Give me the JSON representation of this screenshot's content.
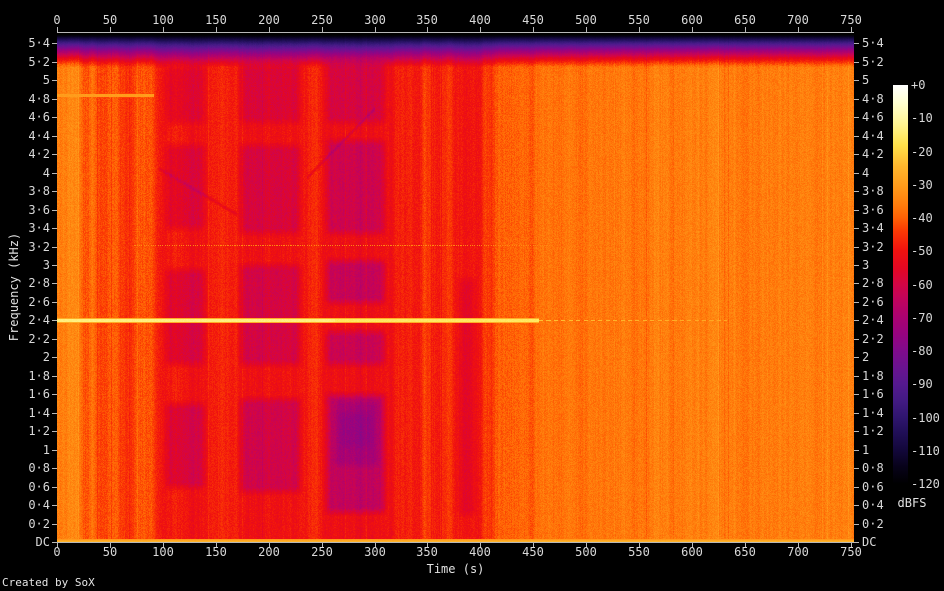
{
  "app": {
    "credit": "Created by SoX"
  },
  "chart_data": {
    "type": "heatmap",
    "subtype": "audio-spectrogram",
    "title": "",
    "xlabel": "Time (s)",
    "ylabel": "Frequency (kHz)",
    "x_range_s": [
      0,
      753
    ],
    "y_range_khz": [
      0,
      5.5125
    ],
    "x_tick_values": [
      0,
      50,
      100,
      150,
      200,
      250,
      300,
      350,
      400,
      450,
      500,
      550,
      600,
      650,
      700,
      750
    ],
    "x_tick_labels": [
      "0",
      "50",
      "100",
      "150",
      "200",
      "250",
      "300",
      "350",
      "400",
      "450",
      "500",
      "550",
      "600",
      "650",
      "700",
      "750"
    ],
    "y_tick_values": [
      0,
      0.2,
      0.4,
      0.6,
      0.8,
      1,
      1.2,
      1.4,
      1.6,
      1.8,
      2,
      2.2,
      2.4,
      2.6,
      2.8,
      3,
      3.2,
      3.4,
      3.6,
      3.8,
      4,
      4.2,
      4.4,
      4.6,
      4.8,
      5,
      5.2,
      5.4
    ],
    "y_tick_labels": [
      "DC",
      "0·2",
      "0·4",
      "0·6",
      "0·8",
      "1",
      "1·2",
      "1·4",
      "1·6",
      "1·8",
      "2",
      "2·2",
      "2·4",
      "2·6",
      "2·8",
      "3",
      "3·2",
      "3·4",
      "3·6",
      "3·8",
      "4",
      "4·2",
      "4·4",
      "4·6",
      "4·8",
      "5",
      "5·2",
      "5·4"
    ],
    "colorbar": {
      "label": "dBFS",
      "range_db": [
        0,
        -120
      ],
      "tick_values": [
        0,
        -10,
        -20,
        -30,
        -40,
        -50,
        -60,
        -70,
        -80,
        -90,
        -100,
        -110,
        -120
      ],
      "tick_labels": [
        "+0",
        "-10",
        "-20",
        "-30",
        "-40",
        "-50",
        "-60",
        "-70",
        "-80",
        "-90",
        "-100",
        "-110",
        "-120"
      ]
    },
    "palette": [
      [
        0.0,
        "#ffffff"
      ],
      [
        0.045,
        "#ffffd0"
      ],
      [
        0.1,
        "#fff48f"
      ],
      [
        0.15,
        "#ffe14a"
      ],
      [
        0.205,
        "#ffb62c"
      ],
      [
        0.255,
        "#ff9a1a"
      ],
      [
        0.3,
        "#ff7d0c"
      ],
      [
        0.33,
        "#ff6405"
      ],
      [
        0.365,
        "#fb3a04"
      ],
      [
        0.415,
        "#f0120f"
      ],
      [
        0.46,
        "#e30723"
      ],
      [
        0.5,
        "#d30545"
      ],
      [
        0.54,
        "#bf035e"
      ],
      [
        0.583,
        "#aa0271"
      ],
      [
        0.625,
        "#970380"
      ],
      [
        0.667,
        "#7f0b8b"
      ],
      [
        0.71,
        "#691390"
      ],
      [
        0.75,
        "#55198f"
      ],
      [
        0.792,
        "#421a83"
      ],
      [
        0.833,
        "#2f156f"
      ],
      [
        0.875,
        "#1f0e55"
      ],
      [
        0.917,
        "#120739"
      ],
      [
        0.958,
        "#070219"
      ],
      [
        1.0,
        "#000000"
      ]
    ],
    "background_time_segments_db": [
      [
        0,
        22,
        -35
      ],
      [
        22,
        30,
        -42
      ],
      [
        30,
        37,
        -38
      ],
      [
        37,
        49,
        -44
      ],
      [
        49,
        59,
        -40
      ],
      [
        59,
        73,
        -45.5
      ],
      [
        73,
        91,
        -41
      ],
      [
        91,
        98,
        -46
      ],
      [
        98,
        122,
        -49
      ],
      [
        122,
        144,
        -51
      ],
      [
        144,
        170,
        -47.5
      ],
      [
        170,
        236,
        -50.5
      ],
      [
        236,
        249,
        -47
      ],
      [
        249,
        318,
        -51.5
      ],
      [
        318,
        344,
        -48
      ],
      [
        344,
        354,
        -44.5
      ],
      [
        354,
        364,
        -48
      ],
      [
        364,
        374,
        -45
      ],
      [
        374,
        401,
        -50
      ],
      [
        401,
        412,
        -44
      ],
      [
        412,
        452,
        -40
      ],
      [
        452,
        500,
        -38
      ],
      [
        500,
        560,
        -37
      ],
      [
        560,
        755,
        -36
      ]
    ],
    "purple_patches": [
      [
        99,
        143,
        0.55,
        1.55,
        -9
      ],
      [
        99,
        143,
        1.88,
        3.0,
        -8
      ],
      [
        99,
        143,
        3.35,
        4.35,
        -7
      ],
      [
        99,
        143,
        4.5,
        5.2,
        -6
      ],
      [
        169,
        233,
        0.5,
        1.6,
        -10
      ],
      [
        169,
        233,
        1.88,
        3.05,
        -9
      ],
      [
        169,
        233,
        3.3,
        4.35,
        -8
      ],
      [
        169,
        233,
        4.5,
        5.22,
        -7
      ],
      [
        251,
        313,
        0.28,
        1.65,
        -13
      ],
      [
        251,
        313,
        1.88,
        2.33,
        -11
      ],
      [
        251,
        313,
        2.55,
        3.1,
        -12
      ],
      [
        251,
        313,
        3.3,
        4.4,
        -10
      ],
      [
        251,
        313,
        4.5,
        5.25,
        -8
      ],
      [
        258,
        308,
        0.78,
        1.58,
        -6
      ],
      [
        263,
        301,
        0.98,
        1.45,
        -4
      ],
      [
        375,
        398,
        0.25,
        2.9,
        -5
      ]
    ],
    "sweep_lines": [
      [
        236,
        300,
        3.95,
        4.7,
        -7
      ],
      [
        96,
        170,
        4.05,
        3.55,
        -6
      ]
    ],
    "tonal_lines": [
      {
        "f": 2.405,
        "t0": 0,
        "t1": 455,
        "level": -13.5,
        "t_dim": 262
      },
      {
        "f": 4.84,
        "t0": 0,
        "t1": 91,
        "level": -30
      }
    ],
    "dashed_lines": [
      {
        "f": 2.405,
        "t0": 455,
        "t1": 633,
        "level": -23,
        "period": 7,
        "duty": 0.55,
        "fade": 5
      },
      {
        "f": 3.217,
        "t0": 72,
        "t1": 465,
        "level": -34,
        "period": 2.2,
        "duty": 0.5,
        "fade": 0
      }
    ],
    "dc_line_db": -25,
    "nyquist_rolloff_start_khz": 5.14,
    "noise_db": 4.4
  }
}
